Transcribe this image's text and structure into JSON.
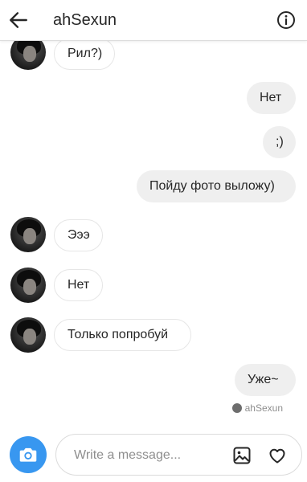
{
  "header": {
    "title": "ahSexun",
    "back_icon": "arrow-left-icon",
    "info_icon": "info-icon"
  },
  "messages": [
    {
      "side": "in",
      "text": "Рил?)"
    },
    {
      "side": "out",
      "text": "Нет"
    },
    {
      "side": "out",
      "text": ";)"
    },
    {
      "side": "out",
      "text": "Пойду фото выложу)"
    },
    {
      "side": "in",
      "text": "Эээ"
    },
    {
      "side": "in",
      "text": "Нет"
    },
    {
      "side": "in",
      "text": "Только попробуй"
    },
    {
      "side": "out",
      "text": "Уже~"
    }
  ],
  "seen_by": "ahSexun",
  "composer": {
    "placeholder": "Write a message...",
    "camera_icon": "camera-icon",
    "gallery_icon": "image-icon",
    "like_icon": "heart-icon"
  },
  "colors": {
    "accent": "#3897f0",
    "outgoing_bubble": "#efefef",
    "incoming_border": "#e6e6e6",
    "muted_text": "#8e8e8e"
  }
}
